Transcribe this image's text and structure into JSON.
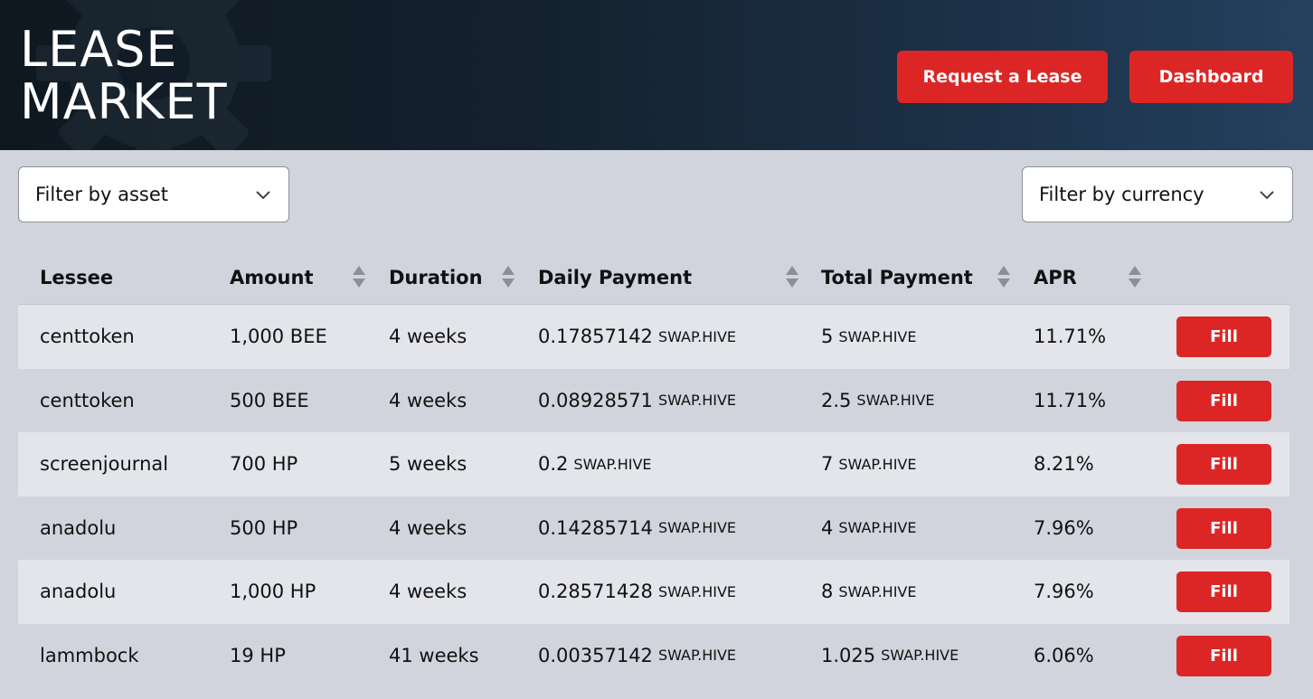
{
  "header": {
    "title_line1": "LEASE",
    "title_line2": "MARKET",
    "request_label": "Request a Lease",
    "dashboard_label": "Dashboard"
  },
  "filters": {
    "asset_label": "Filter by asset",
    "currency_label": "Filter by currency"
  },
  "columns": {
    "lessee": "Lessee",
    "amount": "Amount",
    "duration": "Duration",
    "daily": "Daily Payment",
    "total": "Total Payment",
    "apr": "APR"
  },
  "rows": [
    {
      "lessee": "centtoken",
      "amount": "1,000 BEE",
      "duration": "4 weeks",
      "daily": "0.17857142",
      "daily_unit": "SWAP.HIVE",
      "total": "5",
      "total_unit": "SWAP.HIVE",
      "apr": "11.71%",
      "action": "Fill"
    },
    {
      "lessee": "centtoken",
      "amount": "500 BEE",
      "duration": "4 weeks",
      "daily": "0.08928571",
      "daily_unit": "SWAP.HIVE",
      "total": "2.5",
      "total_unit": "SWAP.HIVE",
      "apr": "11.71%",
      "action": "Fill"
    },
    {
      "lessee": "screenjournal",
      "amount": "700 HP",
      "duration": "5 weeks",
      "daily": "0.2",
      "daily_unit": "SWAP.HIVE",
      "total": "7",
      "total_unit": "SWAP.HIVE",
      "apr": "8.21%",
      "action": "Fill"
    },
    {
      "lessee": "anadolu",
      "amount": "500 HP",
      "duration": "4 weeks",
      "daily": "0.14285714",
      "daily_unit": "SWAP.HIVE",
      "total": "4",
      "total_unit": "SWAP.HIVE",
      "apr": "7.96%",
      "action": "Fill"
    },
    {
      "lessee": "anadolu",
      "amount": "1,000 HP",
      "duration": "4 weeks",
      "daily": "0.28571428",
      "daily_unit": "SWAP.HIVE",
      "total": "8",
      "total_unit": "SWAP.HIVE",
      "apr": "7.96%",
      "action": "Fill"
    },
    {
      "lessee": "lammbock",
      "amount": "19 HP",
      "duration": "41 weeks",
      "daily": "0.00357142",
      "daily_unit": "SWAP.HIVE",
      "total": "1.025",
      "total_unit": "SWAP.HIVE",
      "apr": "6.06%",
      "action": "Fill"
    }
  ],
  "colors": {
    "accent": "#dc2626",
    "page_bg": "#d1d4dc",
    "row_alt": "#e3e5ea",
    "header_dark": "#0e1820"
  }
}
